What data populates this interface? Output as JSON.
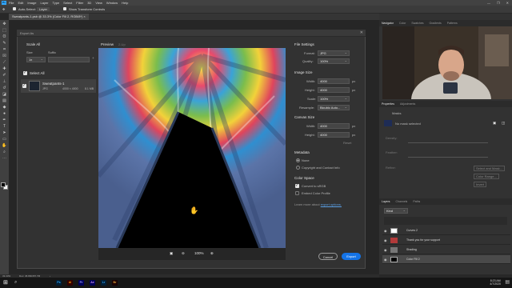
{
  "menubar": {
    "logo": "Ps",
    "items": [
      "File",
      "Edit",
      "Image",
      "Layer",
      "Type",
      "Select",
      "Filter",
      "3D",
      "View",
      "Window",
      "Help"
    ],
    "window_controls": [
      "—",
      "❐",
      "✕"
    ]
  },
  "options_bar": {
    "auto_select_label": "Auto-Select:",
    "auto_select_value": "Layer",
    "transform_label": "Show Transform Controls"
  },
  "document": {
    "tab_title": "Sweatpants-1.psb @ 33.3% (Color Fill 2, RGB/8*) ×"
  },
  "export_dialog": {
    "title": "Export As",
    "scale_all": {
      "heading": "Scale All",
      "size_label": "Size",
      "suffix_label": "Suffix",
      "size_value": "1x",
      "add_icon": "+"
    },
    "select_all_label": "Select All",
    "asset": {
      "name": "Sweatpants-1",
      "format": "JPG",
      "dims": "4000 × 4000",
      "filesize": "8.1 MB"
    },
    "preview_tabs": [
      "Preview",
      "2-Up"
    ],
    "file_settings": {
      "heading": "File Settings",
      "format_label": "Format:",
      "format_value": "JPG",
      "quality_label": "Quality:",
      "quality_value": "100%"
    },
    "image_size": {
      "heading": "Image Size",
      "width_label": "Width:",
      "width_value": "4000",
      "height_label": "Height:",
      "height_value": "4000",
      "unit": "px",
      "scale_label": "Scale:",
      "scale_value": "100%",
      "resample_label": "Resample:",
      "resample_value": "Bicubic Auto..."
    },
    "canvas_size": {
      "heading": "Canvas Size",
      "width_label": "Width:",
      "width_value": "4000",
      "height_label": "Height:",
      "height_value": "4000",
      "unit": "px",
      "reset_label": "Reset"
    },
    "metadata": {
      "heading": "Metadata",
      "options": [
        "None",
        "Copyright and Contact Info"
      ],
      "selected": 0
    },
    "color_space": {
      "heading": "Color Space",
      "convert_label": "Convert to sRGB",
      "embed_label": "Embed Color Profile",
      "convert_checked": true,
      "embed_checked": false
    },
    "learn_more_text": "Learn more about",
    "learn_more_link": "export options.",
    "zoom_value": "100%",
    "cancel_label": "Cancel",
    "export_label": "Export"
  },
  "right_panel": {
    "top_tabs": [
      "Navigator",
      "Color",
      "Swatches",
      "Gradients",
      "Patterns"
    ],
    "properties_tabs": [
      "Properties",
      "Adjustments"
    ],
    "properties_title": "Masks",
    "no_mask": "No mask selected",
    "density_label": "Density:",
    "feather_label": "Feather:",
    "refine_label": "Refine:",
    "refine_buttons": [
      "Select and Mask...",
      "Color Range...",
      "Invert"
    ],
    "layers_tabs": [
      "Layers",
      "Channels",
      "Paths"
    ],
    "layers_kind": "Kind",
    "layers": [
      {
        "name": "Curves 2"
      },
      {
        "name": "Thank you for your support"
      },
      {
        "name": "Shading"
      },
      {
        "name": "Color Fill 2"
      }
    ]
  },
  "status_bar": {
    "zoom": "33.33%",
    "doc": "Doc: 45.8M/457.7M",
    "arrow": "›"
  },
  "taskbar": {
    "apps": [
      "Ps",
      "Ai",
      "Pr",
      "Ae",
      "Lr",
      "Br"
    ],
    "time": "8:23 AM",
    "date": "4/7/2020"
  },
  "colors": {
    "accent": "#1473e6",
    "panel": "#323232",
    "app_bg": "#282828"
  }
}
